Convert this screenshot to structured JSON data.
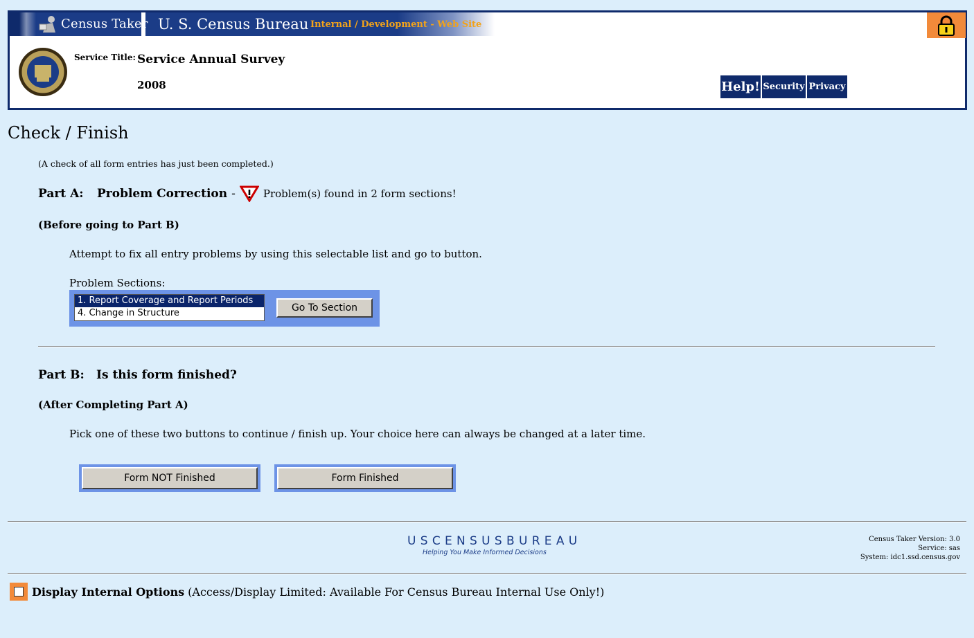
{
  "header": {
    "app_name": "Census Taker",
    "bureau_name": "U. S. Census Bureau",
    "site_tag": "Internal / Development - Web Site",
    "service_title_label": "Service Title:",
    "service_title": "Service Annual Survey",
    "year": "2008",
    "buttons": {
      "help": "Help!",
      "security": "Security",
      "privacy": "Privacy"
    }
  },
  "page": {
    "title": "Check / Finish",
    "check_note": "(A check of all form entries has just been completed.)"
  },
  "part_a": {
    "label": "Part A:",
    "title": "Problem Correction",
    "separator": "-",
    "problem_message": "Problem(s) found in 2 form sections!",
    "subtitle": "(Before going to Part B)",
    "instruction": "Attempt to fix all entry problems by using this selectable list and go to button.",
    "list_label": "Problem Sections:",
    "sections": [
      "1. Report Coverage and Report Periods",
      "4. Change in Structure"
    ],
    "goto_button": "Go To Section"
  },
  "part_b": {
    "label": "Part B:",
    "title": "Is this form finished?",
    "subtitle": "(After Completing Part A)",
    "instruction": "Pick one of these two buttons to continue / finish up.  Your choice here can always be changed at a later time.",
    "not_finished_button": "Form NOT Finished",
    "finished_button": "Form Finished"
  },
  "footer": {
    "logo_text": "USCENSUSBUREAU",
    "logo_tagline": "Helping You Make Informed Decisions",
    "version_line": "Census Taker Version: 3.0",
    "service_line": "Service: sas",
    "system_line": "System: idc1.ssd.census.gov"
  },
  "internal_options": {
    "label": "Display Internal Options",
    "note": "(Access/Display Limited: Available For Census Bureau Internal Use Only!)"
  },
  "colors": {
    "navy": "#0f2a6b",
    "accent_orange": "#f28a3a",
    "panel_blue": "#6d93e6",
    "page_bg": "#dceefb",
    "warning_red": "#cc0000"
  }
}
